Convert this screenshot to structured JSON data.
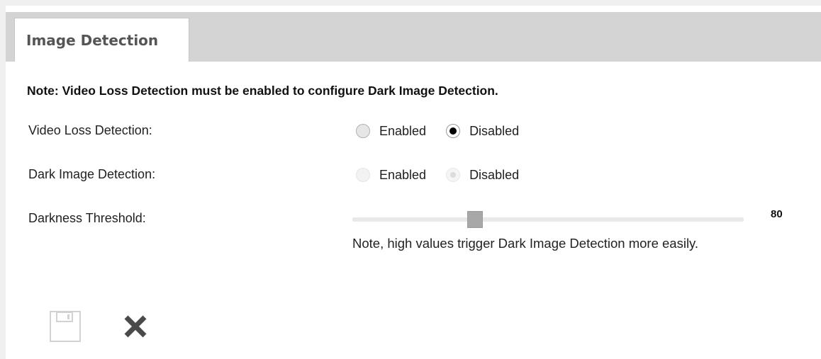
{
  "tabs": [
    {
      "label": "Image Detection",
      "active": true
    }
  ],
  "form": {
    "note": "Note: Video Loss Detection must be enabled to configure Dark Image Detection.",
    "video_loss": {
      "label": "Video Loss Detection:",
      "options": [
        "Enabled",
        "Disabled"
      ],
      "selected": "Disabled",
      "enabled": true
    },
    "dark_image": {
      "label": "Dark Image Detection:",
      "options": [
        "Enabled",
        "Disabled"
      ],
      "selected": "Disabled",
      "enabled": false
    },
    "darkness_threshold": {
      "label": "Darkness Threshold:",
      "value": "80",
      "min": 0,
      "max": 255,
      "hint": "Note, high values trigger Dark Image Detection more easily."
    }
  },
  "toolbar": {
    "save_icon": "floppy-disk-icon",
    "cancel_icon": "close-x-icon"
  },
  "colors": {
    "tabbar_bg": "#d4d4d4",
    "slider_track": "#e9e9e9",
    "slider_handle": "#a8a8a8",
    "cancel_icon": "#4a4a4a",
    "save_icon_disabled": "#d2d2d2"
  }
}
